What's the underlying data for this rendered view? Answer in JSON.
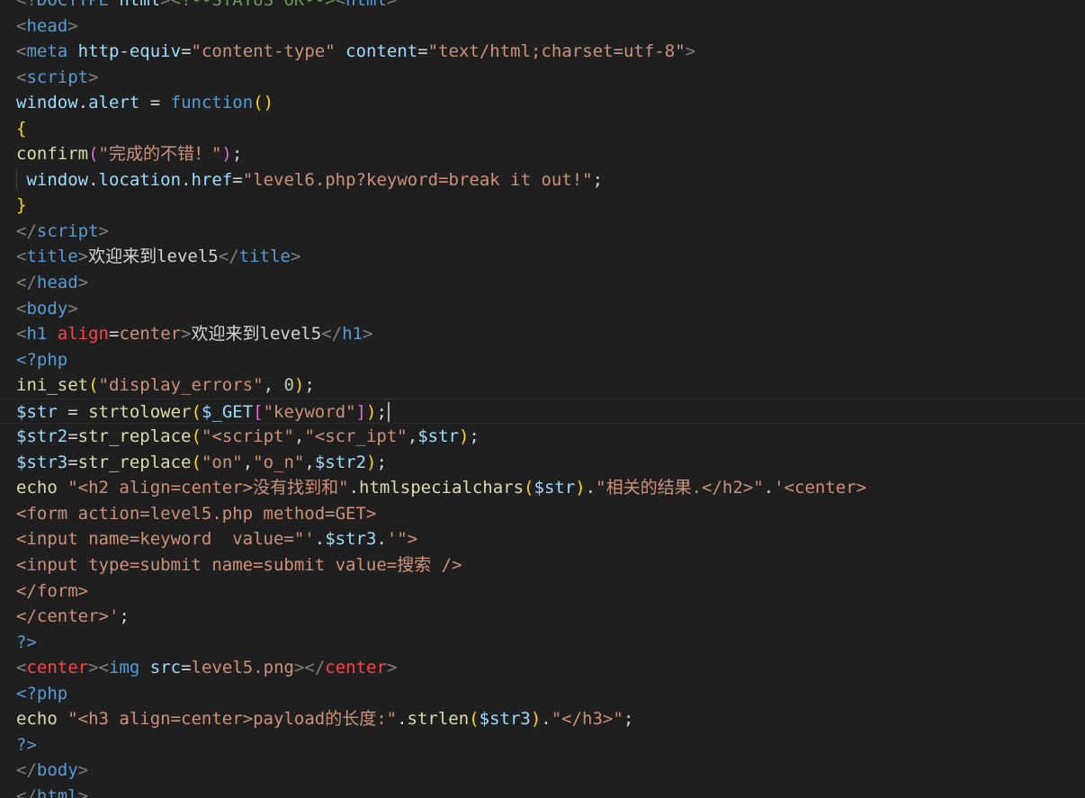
{
  "colors": {
    "background": "#1f1f1f",
    "punctuation": "#808080",
    "tag": "#569cd6",
    "attribute": "#9cdcfe",
    "string": "#ce9178",
    "function": "#dcdcaa",
    "keyword": "#569cd6",
    "variable": "#9cdcfe",
    "bracket1": "#ffd700",
    "bracket2": "#da70d6",
    "bracket3": "#179fff",
    "number": "#b5cea8",
    "comment": "#6a9955",
    "text": "#d4d4d4",
    "entity": "#f44747"
  },
  "code_lines": [
    {
      "tokens": [
        [
          "<!",
          "punctuation"
        ],
        [
          "DOCTYPE",
          "tag"
        ],
        [
          " ",
          "text"
        ],
        [
          "html",
          "attribute"
        ],
        [
          ">",
          "punctuation"
        ],
        [
          "<!--STATUS OK-->",
          "comment"
        ],
        [
          "<",
          "punctuation"
        ],
        [
          "html",
          "tag"
        ],
        [
          ">",
          "punctuation"
        ]
      ]
    },
    {
      "tokens": [
        [
          "<",
          "punctuation"
        ],
        [
          "head",
          "tag"
        ],
        [
          ">",
          "punctuation"
        ]
      ]
    },
    {
      "tokens": [
        [
          "<",
          "punctuation"
        ],
        [
          "meta",
          "tag"
        ],
        [
          " ",
          "text"
        ],
        [
          "http-equiv",
          "attribute"
        ],
        [
          "=",
          "text"
        ],
        [
          "\"content-type\"",
          "string"
        ],
        [
          " ",
          "text"
        ],
        [
          "content",
          "attribute"
        ],
        [
          "=",
          "text"
        ],
        [
          "\"text/html;charset=utf-8\"",
          "string"
        ],
        [
          ">",
          "punctuation"
        ]
      ]
    },
    {
      "tokens": [
        [
          "<",
          "punctuation"
        ],
        [
          "script",
          "tag"
        ],
        [
          ">",
          "punctuation"
        ]
      ]
    },
    {
      "tokens": [
        [
          "window",
          "variable"
        ],
        [
          ".",
          "text"
        ],
        [
          "alert",
          "variable"
        ],
        [
          " = ",
          "text"
        ],
        [
          "function",
          "keyword"
        ],
        [
          "()",
          "bracket1"
        ]
      ]
    },
    {
      "tokens": [
        [
          "{",
          "bracket1"
        ]
      ]
    },
    {
      "tokens": [
        [
          "confirm",
          "function"
        ],
        [
          "(",
          "bracket2"
        ],
        [
          "\"完成的不错！\"",
          "string"
        ],
        [
          ")",
          "bracket2"
        ],
        [
          ";",
          "text"
        ]
      ]
    },
    {
      "indent": true,
      "tokens": [
        [
          " ",
          "text"
        ],
        [
          "window",
          "variable"
        ],
        [
          ".",
          "text"
        ],
        [
          "location",
          "variable"
        ],
        [
          ".",
          "text"
        ],
        [
          "href",
          "variable"
        ],
        [
          "=",
          "text"
        ],
        [
          "\"level6.php?keyword=break it out!\"",
          "string"
        ],
        [
          ";",
          "text"
        ]
      ]
    },
    {
      "tokens": [
        [
          "}",
          "bracket1"
        ]
      ]
    },
    {
      "tokens": [
        [
          "</",
          "punctuation"
        ],
        [
          "script",
          "tag"
        ],
        [
          ">",
          "punctuation"
        ]
      ]
    },
    {
      "tokens": [
        [
          "<",
          "punctuation"
        ],
        [
          "title",
          "tag"
        ],
        [
          ">",
          "punctuation"
        ],
        [
          "欢迎来到level5",
          "text"
        ],
        [
          "</",
          "punctuation"
        ],
        [
          "title",
          "tag"
        ],
        [
          ">",
          "punctuation"
        ]
      ]
    },
    {
      "tokens": [
        [
          "</",
          "punctuation"
        ],
        [
          "head",
          "tag"
        ],
        [
          ">",
          "punctuation"
        ]
      ]
    },
    {
      "tokens": [
        [
          "<",
          "punctuation"
        ],
        [
          "body",
          "tag"
        ],
        [
          ">",
          "punctuation"
        ]
      ]
    },
    {
      "tokens": [
        [
          "<",
          "punctuation"
        ],
        [
          "h1",
          "tag"
        ],
        [
          " ",
          "text"
        ],
        [
          "align",
          "entity"
        ],
        [
          "=",
          "text"
        ],
        [
          "center",
          "string"
        ],
        [
          ">",
          "punctuation"
        ],
        [
          "欢迎来到level5",
          "text"
        ],
        [
          "</",
          "punctuation"
        ],
        [
          "h1",
          "tag"
        ],
        [
          ">",
          "punctuation"
        ]
      ]
    },
    {
      "tokens": [
        [
          "<?php",
          "tag"
        ]
      ]
    },
    {
      "tokens": [
        [
          "ini_set",
          "function"
        ],
        [
          "(",
          "bracket1"
        ],
        [
          "\"display_errors\"",
          "string"
        ],
        [
          ", ",
          "text"
        ],
        [
          "0",
          "number"
        ],
        [
          ")",
          "bracket1"
        ],
        [
          ";",
          "text"
        ]
      ]
    },
    {
      "current": true,
      "tokens": [
        [
          "$str",
          "variable"
        ],
        [
          " = ",
          "text"
        ],
        [
          "strtolower",
          "function"
        ],
        [
          "(",
          "bracket1"
        ],
        [
          "$_GET",
          "variable"
        ],
        [
          "[",
          "bracket2"
        ],
        [
          "\"keyword\"",
          "string"
        ],
        [
          "]",
          "bracket2"
        ],
        [
          ")",
          "bracket1"
        ],
        [
          ";",
          "text"
        ]
      ]
    },
    {
      "tokens": [
        [
          "$str2",
          "variable"
        ],
        [
          "=",
          "text"
        ],
        [
          "str_replace",
          "function"
        ],
        [
          "(",
          "bracket1"
        ],
        [
          "\"<script\"",
          "string"
        ],
        [
          ",",
          "text"
        ],
        [
          "\"<scr_ipt\"",
          "string"
        ],
        [
          ",",
          "text"
        ],
        [
          "$str",
          "variable"
        ],
        [
          ")",
          "bracket1"
        ],
        [
          ";",
          "text"
        ]
      ]
    },
    {
      "tokens": [
        [
          "$str3",
          "variable"
        ],
        [
          "=",
          "text"
        ],
        [
          "str_replace",
          "function"
        ],
        [
          "(",
          "bracket1"
        ],
        [
          "\"on\"",
          "string"
        ],
        [
          ",",
          "text"
        ],
        [
          "\"o_n\"",
          "string"
        ],
        [
          ",",
          "text"
        ],
        [
          "$str2",
          "variable"
        ],
        [
          ")",
          "bracket1"
        ],
        [
          ";",
          "text"
        ]
      ]
    },
    {
      "tokens": [
        [
          "echo",
          "function"
        ],
        [
          " ",
          "text"
        ],
        [
          "\"<h2 align=center>没有找到和\"",
          "string"
        ],
        [
          ".",
          "text"
        ],
        [
          "htmlspecialchars",
          "function"
        ],
        [
          "(",
          "bracket1"
        ],
        [
          "$str",
          "variable"
        ],
        [
          ")",
          "bracket1"
        ],
        [
          ".",
          "text"
        ],
        [
          "\"相关的结果.</h2>\"",
          "string"
        ],
        [
          ".",
          "text"
        ],
        [
          "'<center>",
          "string"
        ]
      ]
    },
    {
      "tokens": [
        [
          "<form action=level5.php method=GET>",
          "string"
        ]
      ]
    },
    {
      "tokens": [
        [
          "<input name=keyword  value=\"'",
          "string"
        ],
        [
          ".",
          "text"
        ],
        [
          "$str3",
          "variable"
        ],
        [
          ".",
          "text"
        ],
        [
          "'\">",
          "string"
        ]
      ]
    },
    {
      "tokens": [
        [
          "<input type=submit name=submit value=搜索 />",
          "string"
        ]
      ]
    },
    {
      "tokens": [
        [
          "</form>",
          "string"
        ]
      ]
    },
    {
      "tokens": [
        [
          "</center>'",
          "string"
        ],
        [
          ";",
          "text"
        ]
      ]
    },
    {
      "tokens": [
        [
          "?>",
          "tag"
        ]
      ]
    },
    {
      "tokens": [
        [
          "<",
          "punctuation"
        ],
        [
          "center",
          "entity"
        ],
        [
          ">",
          "punctuation"
        ],
        [
          "<",
          "punctuation"
        ],
        [
          "img",
          "tag"
        ],
        [
          " ",
          "text"
        ],
        [
          "src",
          "attribute"
        ],
        [
          "=",
          "text"
        ],
        [
          "level5.png",
          "string"
        ],
        [
          ">",
          "punctuation"
        ],
        [
          "</",
          "punctuation"
        ],
        [
          "center",
          "entity"
        ],
        [
          ">",
          "punctuation"
        ]
      ]
    },
    {
      "tokens": [
        [
          "<?php",
          "tag"
        ]
      ]
    },
    {
      "tokens": [
        [
          "echo",
          "function"
        ],
        [
          " ",
          "text"
        ],
        [
          "\"<h3 align=center>payload的长度:\"",
          "string"
        ],
        [
          ".",
          "text"
        ],
        [
          "strlen",
          "function"
        ],
        [
          "(",
          "bracket1"
        ],
        [
          "$str3",
          "variable"
        ],
        [
          ")",
          "bracket1"
        ],
        [
          ".",
          "text"
        ],
        [
          "\"</h3>\"",
          "string"
        ],
        [
          ";",
          "text"
        ]
      ]
    },
    {
      "tokens": [
        [
          "?>",
          "tag"
        ]
      ]
    },
    {
      "tokens": [
        [
          "</",
          "punctuation"
        ],
        [
          "body",
          "tag"
        ],
        [
          ">",
          "punctuation"
        ]
      ]
    },
    {
      "tokens": [
        [
          "</",
          "punctuation"
        ],
        [
          "html",
          "tag"
        ],
        [
          ">",
          "punctuation"
        ]
      ]
    }
  ]
}
